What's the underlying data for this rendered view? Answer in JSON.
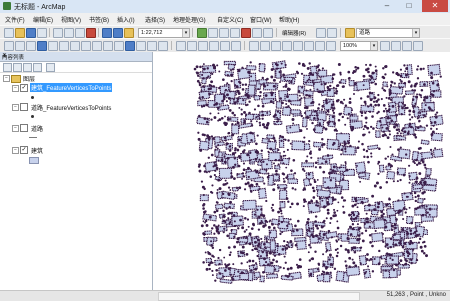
{
  "window": {
    "title": "无标题 - ArcMap"
  },
  "menu": [
    {
      "label": "文件(F)"
    },
    {
      "label": "编辑(E)"
    },
    {
      "label": "视图(V)"
    },
    {
      "label": "书签(B)"
    },
    {
      "label": "插入(I)"
    },
    {
      "label": "选择(S)"
    },
    {
      "label": "地理处理(G)"
    },
    {
      "label": "自定义(C)"
    },
    {
      "label": "窗口(W)"
    },
    {
      "label": "帮助(H)"
    }
  ],
  "toolbar": {
    "scale": "1:22,712",
    "editor_label": "编辑器(R)",
    "layer_select": "道路",
    "zoom": "100%"
  },
  "toc": {
    "title": "内容列表",
    "root": "图层",
    "layers": [
      {
        "name": "建筑_FeatureVerticesToPoints",
        "checked": true,
        "selected": true
      },
      {
        "name": "道路_FeatureVerticesToPoints",
        "checked": false,
        "selected": false
      },
      {
        "name": "道路",
        "checked": false,
        "selected": false
      },
      {
        "name": "建筑",
        "checked": true,
        "selected": false
      }
    ]
  },
  "status": {
    "coordinates": "51,263  ,  Point  ,  Unkno"
  },
  "colors": {
    "points": "#3a1d49",
    "building_fill": "#c8d2ec"
  }
}
